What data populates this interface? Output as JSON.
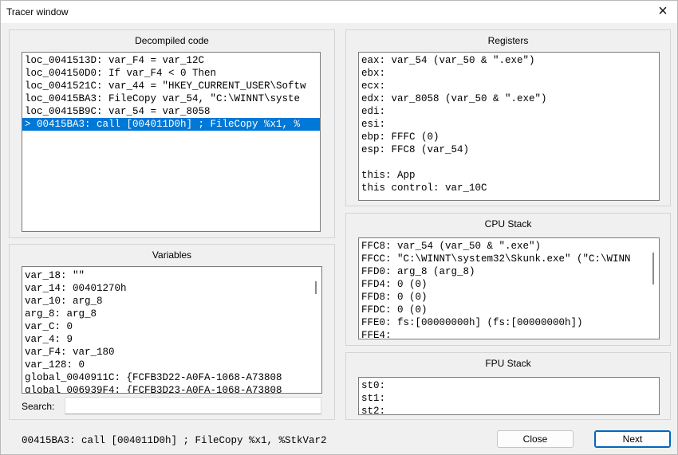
{
  "window": {
    "title": "Tracer window",
    "close_icon": "×"
  },
  "decompiled": {
    "title": "Decompiled code",
    "rows": [
      "loc_0041513D: var_F4 = var_12C",
      "loc_004150D0: If var_F4 < 0 Then",
      "loc_0041521C: var_44 = \"HKEY_CURRENT_USER\\Softw",
      "loc_00415BA3: FileCopy var_54, \"C:\\WINNT\\syste",
      "loc_00415B9C: var_54 = var_8058",
      "> 00415BA3: call [004011D0h] ; FileCopy %x1, %"
    ],
    "selected_index": 5
  },
  "variables": {
    "title": "Variables",
    "rows": [
      "var_18: \"\"",
      "var_14: 00401270h",
      "var_10: arg_8",
      "arg_8: arg_8",
      "var_C: 0",
      "var_4: 9",
      "var_F4: var_180",
      "var_128: 0",
      "global_0040911C: {FCFB3D22-A0FA-1068-A73808",
      "global_006939F4: {FCFB3D23-A0FA-1068-A73808"
    ],
    "search_label": "Search:",
    "search_value": ""
  },
  "registers": {
    "title": "Registers",
    "rows": [
      "eax: var_54 (var_50 & \".exe\")",
      "ebx:",
      "ecx:",
      "edx: var_8058 (var_50 & \".exe\")",
      "edi:",
      "esi:",
      "ebp: FFFC (0)",
      "esp: FFC8 (var_54)",
      "",
      "this: App",
      "this control: var_10C"
    ]
  },
  "cpu_stack": {
    "title": "CPU Stack",
    "rows": [
      "FFC8: var_54 (var_50 & \".exe\")",
      "FFCC: \"C:\\WINNT\\system32\\Skunk.exe\" (\"C:\\WINN",
      "FFD0: arg_8 (arg_8)",
      "FFD4: 0 (0)",
      "FFD8: 0 (0)",
      "FFDC: 0 (0)",
      "FFE0: fs:[00000000h] (fs:[00000000h])",
      "FFE4:"
    ]
  },
  "fpu_stack": {
    "title": "FPU Stack",
    "rows": [
      "st0:",
      "st1:",
      "st2:"
    ]
  },
  "status_text": "00415BA3: call [004011D0h] ; FileCopy %x1, %StkVar2",
  "buttons": {
    "close": "Close",
    "next": "Next"
  }
}
